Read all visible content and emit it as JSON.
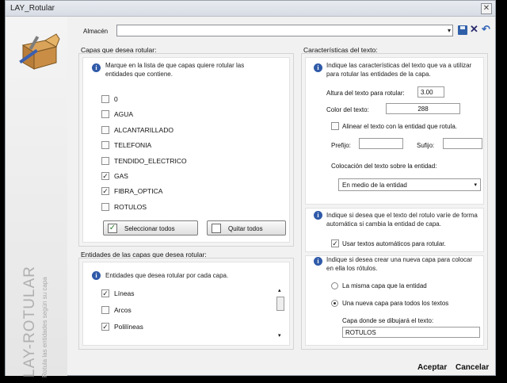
{
  "window": {
    "title": "LAY_Rotular",
    "close_glyph": "✕"
  },
  "sidebar": {
    "app_title": "LAY-ROTULAR",
    "subtitle": "Rotula las entidades según su capa",
    "logo_icon": "box-tools-icon"
  },
  "almacen": {
    "label": "Almacén",
    "value": "",
    "dropdown_glyph": "▾",
    "save_icon": "floppy-save-icon",
    "delete_glyph": "✕",
    "undo_glyph": "↶"
  },
  "capas": {
    "title": "Capas que desea rotular:",
    "info": "Marque en la lista de que capas quiere rotular las entidades que contiene.",
    "items": [
      {
        "label": "0",
        "checked": false
      },
      {
        "label": "AGUA",
        "checked": false
      },
      {
        "label": "ALCANTARILLADO",
        "checked": false
      },
      {
        "label": "TELEFONIA",
        "checked": false
      },
      {
        "label": "TENDIDO_ELECTRICO",
        "checked": false
      },
      {
        "label": "GAS",
        "checked": true
      },
      {
        "label": "FIBRA_OPTICA",
        "checked": true
      },
      {
        "label": "ROTULOS",
        "checked": false
      }
    ],
    "select_all": "Seleccionar todos",
    "deselect_all": "Quitar todos"
  },
  "entidades": {
    "title": "Entidades de las capas que desea rotular:",
    "info": "Entidades que desea rotular por cada capa.",
    "items": [
      {
        "label": "Líneas",
        "checked": true
      },
      {
        "label": "Arcos",
        "checked": false
      },
      {
        "label": "Polilíneas",
        "checked": true
      }
    ],
    "scroll_up": "▴",
    "scroll_down": "▾"
  },
  "texto": {
    "title": "Características del texto:",
    "info": "Indique las características del texto que va a utilizar para rotular las entidades de la capa.",
    "altura_label": "Altura del texto para rotular:",
    "altura_value": "3.00",
    "color_label": "Color del texto:",
    "color_value": "288",
    "alinear_label": "Alinear el texto con la entidad que rotula.",
    "alinear_checked": false,
    "prefijo_label": "Prefijo:",
    "prefijo_value": "",
    "sufijo_label": "Sufijo:",
    "sufijo_value": "",
    "colocacion_label": "Colocación del texto sobre la entidad:",
    "colocacion_value": "En medio de la entidad",
    "info2": "Indique si desea que el texto del rotulo varíe de forma automática si cambia la entidad de capa.",
    "auto_label": "Usar textos automáticos para rotular.",
    "auto_checked": true,
    "info3": "Indique si desea crear una nueva capa para colocar en ella los rótulos.",
    "radio_misma": "La misma capa que la entidad",
    "radio_nueva": "Una nueva capa para todos los textos",
    "radio_selected": "nueva",
    "capa_label": "Capa donde se dibujará el texto:",
    "capa_value": "ROTULOS"
  },
  "footer": {
    "accept": "Aceptar",
    "cancel": "Cancelar"
  }
}
